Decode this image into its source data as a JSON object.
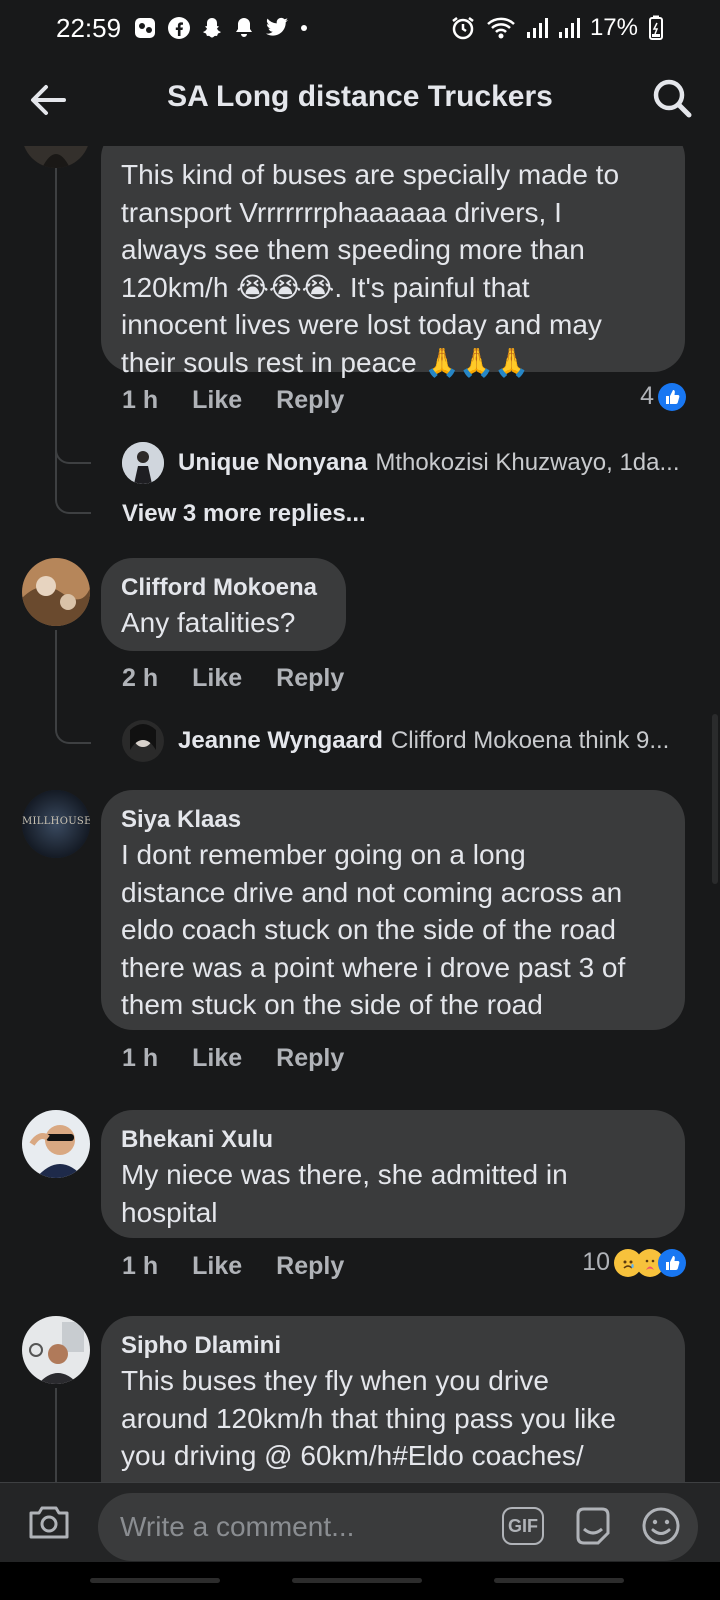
{
  "status_bar": {
    "time": "22:59",
    "battery": "17%",
    "left_icons": [
      "gallery-icon",
      "facebook-icon",
      "snapchat-icon",
      "bell-icon",
      "twitter-icon"
    ],
    "right_icons": [
      "alarm-icon",
      "wifi-icon",
      "signal-icon",
      "signal-icon-2",
      "battery-icon"
    ]
  },
  "header": {
    "title": "SA Long distance Truckers"
  },
  "comments": [
    {
      "text": "This kind of buses are specially made to transport Vrrrrrrrphaaaaaa drivers, I always see them speeding more than 120km/h 😭😭😭. It's painful that innocent lives were lost today and may their souls rest in peace 🙏🙏🙏",
      "lines": [
        "This kind of buses are specially made to",
        "transport Vrrrrrrrphaaaaaa drivers, I",
        "always see them speeding more than",
        "120km/h 😭😭😭. It's painful that",
        "innocent lives were lost today and may",
        "their souls rest in peace 🙏🙏🙏"
      ],
      "time": "1 h",
      "like": "Like",
      "reply": "Reply",
      "reaction_count": "4",
      "reply_preview": {
        "name": "Unique Nonyana",
        "text": "Mthokozisi Khuzwayo, 1da..."
      },
      "view_more": "View 3 more replies..."
    },
    {
      "author": "Clifford Mokoena",
      "text": "Any fatalities?",
      "time": "2 h",
      "like": "Like",
      "reply": "Reply",
      "reply_preview": {
        "name": "Jeanne Wyngaard",
        "text": "Clifford Mokoena think 9..."
      }
    },
    {
      "author": "Siya Klaas",
      "avatar_text": "MILLHOUSE",
      "lines": [
        "I dont remember going on a long",
        "distance drive and not coming across an",
        "eldo coach stuck on the side of the road",
        "there was a point where i drove past 3 of",
        "them stuck on the side of the road"
      ],
      "time": "1 h",
      "like": "Like",
      "reply": "Reply"
    },
    {
      "author": "Bhekani Xulu",
      "lines": [
        "My niece was there, she admitted in",
        "hospital"
      ],
      "time": "1 h",
      "like": "Like",
      "reply": "Reply",
      "reaction_count": "10"
    },
    {
      "author": "Sipho Dlamini",
      "lines": [
        "This buses they fly when you drive",
        "around 120km/h that thing pass you like",
        "you driving @ 60km/h#Eldo coaches/"
      ]
    }
  ],
  "composer": {
    "placeholder": "Write a comment...",
    "gif_label": "GIF"
  },
  "colors": {
    "background": "#18191a",
    "bubble": "#3a3b3c",
    "text": "#e4e6eb",
    "secondary_text": "#b0b3b8",
    "like_blue": "#1877f2"
  }
}
